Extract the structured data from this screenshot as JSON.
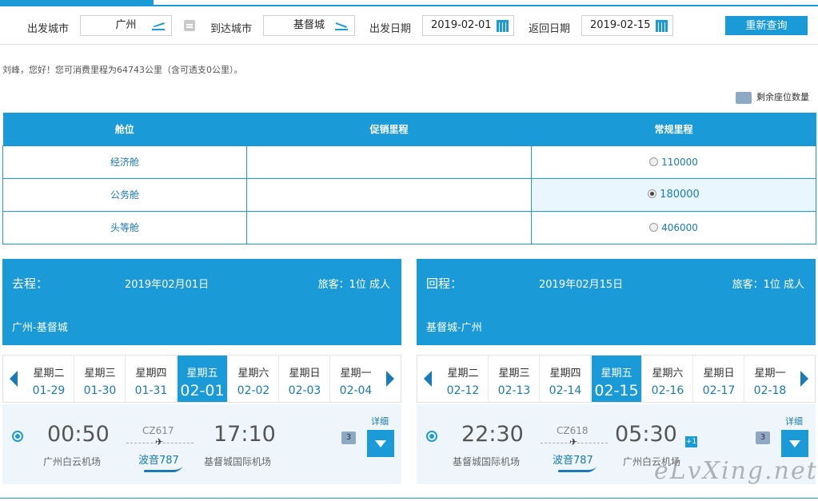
{
  "search": {
    "from_label": "出发城市",
    "from_value": "广州",
    "to_label": "到达城市",
    "to_value": "基督城",
    "depart_label": "出发日期",
    "depart_value": "2019-02-01",
    "return_label": "返回日期",
    "return_value": "2019-02-15",
    "requery_label": "重新查询"
  },
  "greeting": "刘峰，您好！您可消费里程为64743公里（含可透支0公里）。",
  "seats_legend": "剩余座位数量",
  "cabin_table": {
    "headers": [
      "舱位",
      "促销里程",
      "常规里程"
    ],
    "rows": [
      {
        "cabin": "经济舱",
        "promo": "",
        "regular": "110000",
        "selected": false
      },
      {
        "cabin": "公务舱",
        "promo": "",
        "regular": "180000",
        "selected": true
      },
      {
        "cabin": "头等舱",
        "promo": "",
        "regular": "406000",
        "selected": false
      }
    ]
  },
  "outbound": {
    "label": "去程：",
    "date": "2019年02月01日",
    "pax": "旅客：1位 成人",
    "route": "广州-基督城",
    "days": [
      {
        "wk": "星期二",
        "dt": "01-29"
      },
      {
        "wk": "星期三",
        "dt": "01-30"
      },
      {
        "wk": "星期四",
        "dt": "01-31"
      },
      {
        "wk": "星期五",
        "dt": "02-01",
        "selected": true
      },
      {
        "wk": "星期六",
        "dt": "02-02"
      },
      {
        "wk": "星期日",
        "dt": "02-03"
      },
      {
        "wk": "星期一",
        "dt": "02-04"
      }
    ],
    "flight": {
      "dep_time": "00:50",
      "dep_airport": "广州白云机场",
      "flight_no": "CZ617",
      "aircraft": "波音787",
      "arr_time": "17:10",
      "arr_airport": "基督城国际机场",
      "seats": "3",
      "detail": "详细"
    }
  },
  "inbound": {
    "label": "回程：",
    "date": "2019年02月15日",
    "pax": "旅客：1位 成人",
    "route": "基督城-广州",
    "days": [
      {
        "wk": "星期二",
        "dt": "02-12"
      },
      {
        "wk": "星期三",
        "dt": "02-13"
      },
      {
        "wk": "星期四",
        "dt": "02-14"
      },
      {
        "wk": "星期五",
        "dt": "02-15",
        "selected": true
      },
      {
        "wk": "星期六",
        "dt": "02-16"
      },
      {
        "wk": "星期日",
        "dt": "02-17"
      },
      {
        "wk": "星期一",
        "dt": "02-18"
      }
    ],
    "flight": {
      "dep_time": "22:30",
      "dep_airport": "基督城国际机场",
      "flight_no": "CZ618",
      "aircraft": "波音787",
      "arr_time": "05:30",
      "arr_day_offset": "+1",
      "arr_airport": "广州白云机场",
      "seats": "3",
      "detail": "详细"
    }
  },
  "watermark": "eLvXing.net",
  "colors": {
    "accent": "#1a9ad6",
    "link": "#1a7ab6",
    "row_highlight": "#eaf6fd"
  }
}
